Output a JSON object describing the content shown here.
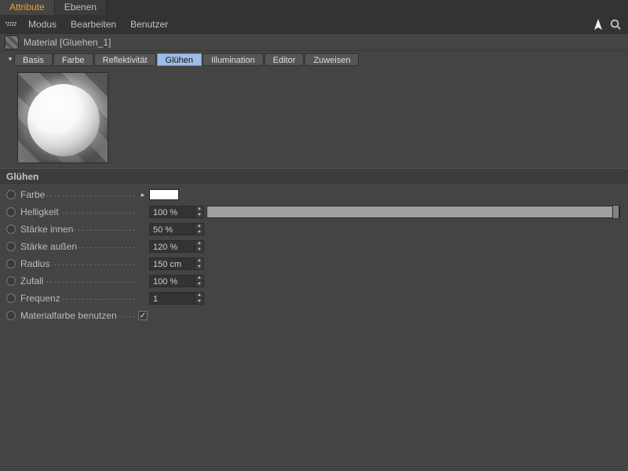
{
  "window_tabs": {
    "attribute": "Attribute",
    "layers": "Ebenen"
  },
  "menu": {
    "mode": "Modus",
    "edit": "Bearbeiten",
    "user": "Benutzer"
  },
  "object": {
    "title": "Material [Gluehen_1]"
  },
  "tabs": {
    "basic": "Basis",
    "color": "Farbe",
    "reflect": "Reflektivität",
    "glow": "Glühen",
    "illum": "Illumination",
    "editor": "Editor",
    "assign": "Zuweisen"
  },
  "section": "Glühen",
  "params": {
    "color_label": "Farbe",
    "color_hex": "#ffffff",
    "brightness_label": "Helligkeit",
    "brightness_value": "100 %",
    "brightness_pct": 100,
    "inner_label": "Stärke innen",
    "inner_value": "50 %",
    "outer_label": "Stärke außen",
    "outer_value": "120 %",
    "radius_label": "Radius",
    "radius_value": "150 cm",
    "random_label": "Zufall",
    "random_value": "100 %",
    "freq_label": "Frequenz",
    "freq_value": "1",
    "usemat_label": "Materialfarbe benutzen",
    "usemat_checked": true
  }
}
